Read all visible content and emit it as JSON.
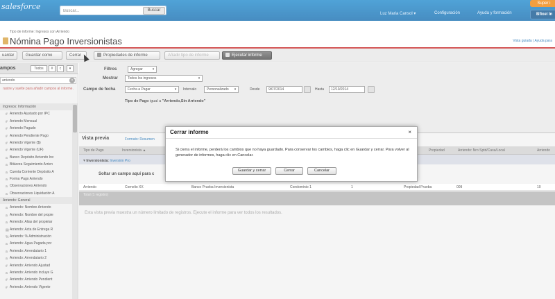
{
  "header": {
    "logo": "salesforce",
    "search_placeholder": "Buscar...",
    "search_button": "Buscar",
    "user_menu": "Luz Maria Cansol ▾",
    "setup": "Configuración",
    "help": "Ayuda y formación",
    "app_pill": "Super i",
    "app_menu": "Bfixel In"
  },
  "page": {
    "breadcrumb": "Tipo de informe: Ingresos con Arriendo",
    "title": "Nómina Pago Inversionistas",
    "header_links": "Vista guiada | Ayuda para"
  },
  "toolbar": {
    "save": "uardar",
    "save_as": "Guardar como",
    "close": "Cerrar",
    "properties": "Propiedades de informe",
    "add_type": "Añadir tipo de informe",
    "run": "Ejecutar informe"
  },
  "sidebar": {
    "title": "ampos",
    "filter_all": "Todos",
    "btn_a": "#",
    "btn_b": "c",
    "search_value": "arriendo",
    "hint": "rastre y suelte para añadir campos al informe.",
    "items": [
      {
        "label": "Ingresos: Información",
        "group": true,
        "marker": ""
      },
      {
        "label": "Arriendo Ajustado por IPC",
        "group": false,
        "marker": "#"
      },
      {
        "label": "Arriendo Mensual",
        "group": false,
        "marker": "#"
      },
      {
        "label": "Arriendo Pagado",
        "group": false,
        "marker": "#"
      },
      {
        "label": "Arriendo Pendiente Pago",
        "group": false,
        "marker": "#"
      },
      {
        "label": "Arriendo Vigente ($)",
        "group": false,
        "marker": "#"
      },
      {
        "label": "Arriendo Vigente (UF)",
        "group": false,
        "marker": "#"
      },
      {
        "label": "Banco Depósito Arriendo Inv",
        "group": false,
        "marker": "a"
      },
      {
        "label": "Bitácora Seguimiento Arrien",
        "group": false,
        "marker": "a"
      },
      {
        "label": "Cuenta Corriente Depósito A",
        "group": false,
        "marker": "a"
      },
      {
        "label": "Forma Pago Arriendo",
        "group": false,
        "marker": "a"
      },
      {
        "label": "Observaciones Arriendo",
        "group": false,
        "marker": "a"
      },
      {
        "label": "Observaciones Liquidación A",
        "group": false,
        "marker": "a"
      },
      {
        "label": "Arriendo: General",
        "group": true,
        "marker": ""
      },
      {
        "label": "Arriendo: Nombre Arriendo",
        "group": false,
        "marker": "a"
      },
      {
        "label": "Arriendo: Nombre del propie",
        "group": false,
        "marker": "a"
      },
      {
        "label": "Arriendo: Alias del propietar",
        "group": false,
        "marker": "a"
      },
      {
        "label": "Arriendo: Acta de Entrega R",
        "group": false,
        "marker": "▤"
      },
      {
        "label": "Arriendo: % Administración",
        "group": false,
        "marker": "%"
      },
      {
        "label": "Arriendo: Agua Pagada por",
        "group": false,
        "marker": "a"
      },
      {
        "label": "Arriendo: Arrendatario 1",
        "group": false,
        "marker": "a"
      },
      {
        "label": "Arriendo: Arrendatario 2",
        "group": false,
        "marker": "a"
      },
      {
        "label": "Arriendo: Arriendo Ajustad",
        "group": false,
        "marker": "#"
      },
      {
        "label": "Arriendo: Arriendo incluye G",
        "group": false,
        "marker": "a"
      },
      {
        "label": "Arriendo: Arriendo Pendient",
        "group": false,
        "marker": "#"
      },
      {
        "label": "Arriendo: Arriendo Vigente",
        "group": false,
        "marker": "#"
      }
    ]
  },
  "filters": {
    "filtros_label": "Filtros",
    "filtros_value": "Agregar",
    "mostrar_label": "Mostrar",
    "mostrar_value": "Todos los ingresos",
    "date_field_label": "Campo de fecha",
    "date_field_value": "Fecha a Pagar",
    "interval_label": "Intervalo",
    "interval_value": "Personalizado",
    "from_label": "Desde",
    "from_value": "9/07/2014",
    "to_label": "Hasta",
    "to_value": "12/10/2014",
    "tipo_pago_prefix": "Tipo de Pago",
    "tipo_pago_op": "igual a",
    "tipo_pago_value": "\"Arriendo,Sin Arriendo\""
  },
  "preview": {
    "title": "Vista previa",
    "format": "Formato: Resumen",
    "columns": [
      "Tipo de Pago",
      "Inversionista ▲",
      "Propiedad",
      "Arriendo: Nro Sptd/Casa/Local",
      "Arriendo"
    ],
    "group_label": "Inversionista:",
    "group_value": "Inversión Pro",
    "drop_hint": "Soltar un campo aquí para c",
    "row": [
      "Arriendo",
      "Cornelio XX",
      "Banco Prueba Inversionista",
      "Condominio 1",
      "1",
      "Propiedad Prueba",
      "009",
      "10"
    ],
    "total_label": "Total (1 registro)",
    "message": "Esta vista previa muestra un número limitado de registros. Ejecute el informe para ver todos los resultados."
  },
  "dialog": {
    "title": "Cerrar informe",
    "close_glyph": "×",
    "body": "Si cierra el informe, perderá los cambios que no haya guardado. Para conservar los cambios, haga clic en Guardar y cerrar. Para volver al generador de informes, haga clic en Cancelar.",
    "save_close": "Guardar y cerrar",
    "close": "Cerrar",
    "cancel": "Cancelar"
  },
  "colors": {
    "header_blue": "#1f74b4",
    "accent_red": "#cc3333",
    "app_orange": "#f08a16"
  }
}
